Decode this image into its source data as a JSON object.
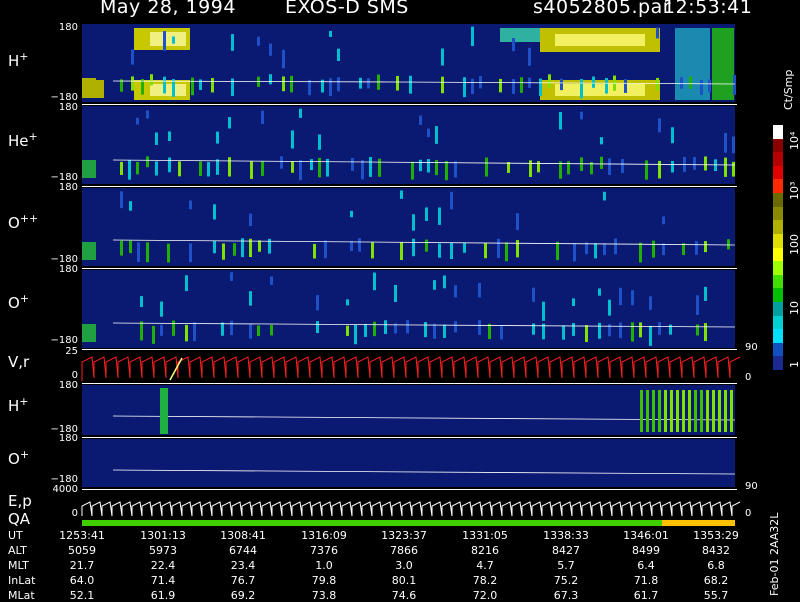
{
  "header": {
    "date": "May 28, 1994",
    "instrument": "EXOS-D SMS",
    "file": "s4052805.par",
    "time": "12:53:41"
  },
  "panels": [
    {
      "label": "H",
      "sup": "+",
      "top_tick": "180",
      "bottom_tick": "−180"
    },
    {
      "label": "He",
      "sup": "+",
      "top_tick": "180",
      "bottom_tick": "−180"
    },
    {
      "label": "O",
      "sup": "++",
      "top_tick": "180",
      "bottom_tick": "−180"
    },
    {
      "label": "O",
      "sup": "+",
      "top_tick": "180",
      "bottom_tick": "−180"
    },
    {
      "label": "V,r",
      "sup": "",
      "top_tick": "25",
      "bottom_tick": "0",
      "right_top": "90",
      "right_bottom": "0"
    },
    {
      "label": "H",
      "sup": "+",
      "top_tick": "180",
      "bottom_tick": "−180"
    },
    {
      "label": "O",
      "sup": "+",
      "top_tick": "180",
      "bottom_tick": "−180"
    },
    {
      "label": "E,p",
      "sup": "",
      "top_tick": "4000",
      "bottom_tick": "0",
      "right_top": "90",
      "right_bottom": "0"
    }
  ],
  "qa_label": "QA",
  "colorbar": {
    "unit": "Ct/Smp",
    "labels": [
      "10⁴",
      "10³",
      "100",
      "10",
      "1"
    ],
    "colors": [
      "#ffffff",
      "#8a0000",
      "#b40000",
      "#e00000",
      "#ff2a00",
      "#6a6a00",
      "#8a8a00",
      "#b0b000",
      "#e0e000",
      "#ffff00",
      "#a0ff00",
      "#40e000",
      "#00c000",
      "#00a0a0",
      "#00d0d0",
      "#00e0ff",
      "#1050c0",
      "#1a2a90"
    ]
  },
  "bottom_table": {
    "rows": [
      {
        "name": "UT",
        "values": [
          "1253:41",
          "1301:13",
          "1308:41",
          "1316:09",
          "1323:37",
          "1331:05",
          "1338:33",
          "1346:01",
          "1353:29"
        ]
      },
      {
        "name": "ALT",
        "values": [
          "5059",
          "5973",
          "6744",
          "7376",
          "7866",
          "8216",
          "8427",
          "8499",
          "8432"
        ]
      },
      {
        "name": "MLT",
        "values": [
          "21.7",
          "22.4",
          "23.4",
          "1.0",
          "3.0",
          "4.7",
          "5.7",
          "6.4",
          "6.8"
        ]
      },
      {
        "name": "InLat",
        "values": [
          "64.0",
          "71.4",
          "76.7",
          "79.8",
          "80.1",
          "78.2",
          "75.2",
          "71.8",
          "68.2"
        ]
      },
      {
        "name": "MLat",
        "values": [
          "52.1",
          "61.9",
          "69.2",
          "73.8",
          "74.6",
          "72.0",
          "67.3",
          "61.7",
          "55.7"
        ]
      }
    ]
  },
  "side_note": "Feb-01  2AA32L",
  "colors": {
    "background": "#000000",
    "panel_bg": "#0a1a73",
    "sweep_red": "#ff2020",
    "qa_green": "#40d000",
    "qa_yellow": "#ffc000"
  }
}
